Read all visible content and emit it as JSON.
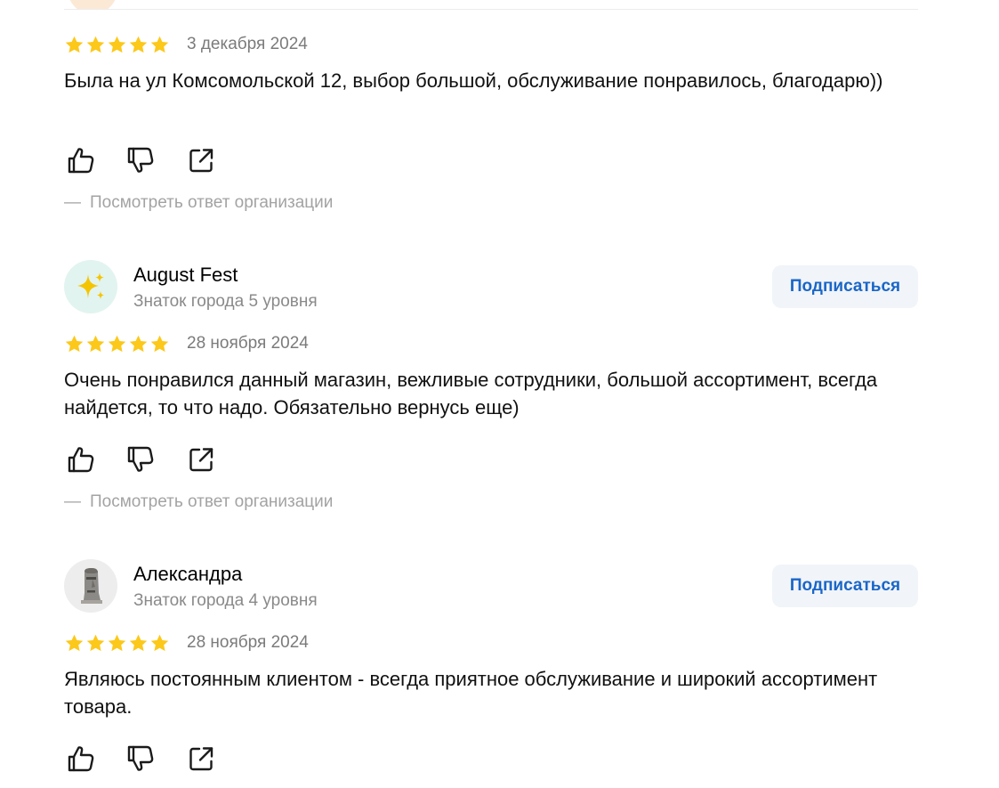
{
  "labels": {
    "subscribe": "Подписаться",
    "org_reply": "Посмотреть ответ организации",
    "org_reply_dash": "—"
  },
  "colors": {
    "star": "#fcc819",
    "subscribe_text": "#1a66c8",
    "subscribe_bg": "#f1f4f8",
    "muted": "#8a8a8a"
  },
  "reviews": [
    {
      "rating": 5,
      "date": "3 декабря 2024",
      "text": "Была на ул Комсомольской 12, выбор большой, обслуживание понравилось, благодарю))",
      "actions": [
        "like-icon",
        "dislike-icon",
        "share-icon"
      ]
    },
    {
      "author": "August Fest",
      "level": "Знаток города 5 уровня",
      "avatar": "sparkles-icon",
      "rating": 5,
      "date": "28 ноября 2024",
      "text": "Очень понравился данный магазин, вежливые сотрудники, большой ассортимент, всегда найдется, то что надо. Обязательно вернусь еще)",
      "actions": [
        "like-icon",
        "dislike-icon",
        "share-icon"
      ]
    },
    {
      "author": "Александра",
      "level": "Знаток города 4 уровня",
      "avatar": "moai-statue-icon",
      "rating": 5,
      "date": "28 ноября 2024",
      "text": "Являюсь постоянным клиентом - всегда приятное обслуживание и широкий ассортимент товара.",
      "actions": [
        "like-icon",
        "dislike-icon",
        "share-icon"
      ]
    }
  ]
}
